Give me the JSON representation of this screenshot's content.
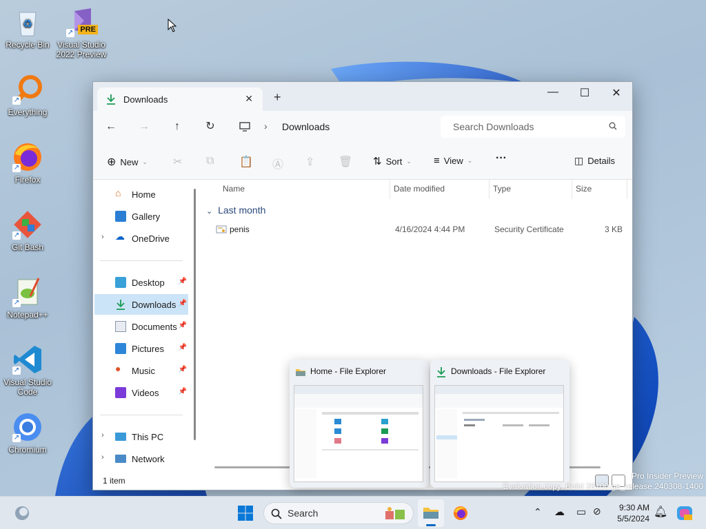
{
  "desktop": {
    "icons": [
      {
        "label": "Recycle Bin"
      },
      {
        "label": "Visual Studio 2022 Preview"
      },
      {
        "label": "Everything"
      },
      {
        "label": "Firefox"
      },
      {
        "label": "Git Bash"
      },
      {
        "label": "Notepad++"
      },
      {
        "label": "Visual Studio Code"
      },
      {
        "label": "Chromium"
      }
    ],
    "vs_badge": "PRE",
    "watermark_line1": "Pro Insider Preview",
    "watermark_line2": "Evaluation copy. Build 26100.ge_release.240308-1400"
  },
  "window": {
    "tab_title": "Downloads",
    "breadcrumb": "Downloads",
    "search_placeholder": "Search Downloads",
    "toolbar": {
      "new_label": "New",
      "sort_label": "Sort",
      "view_label": "View",
      "more_label": "···",
      "details_label": "Details"
    },
    "nav": {
      "home": "Home",
      "gallery": "Gallery",
      "onedrive": "OneDrive",
      "desktop": "Desktop",
      "downloads": "Downloads",
      "documents": "Documents",
      "pictures": "Pictures",
      "music": "Music",
      "videos": "Videos",
      "thispc": "This PC",
      "network": "Network"
    },
    "columns": {
      "name": "Name",
      "date": "Date modified",
      "type": "Type",
      "size": "Size"
    },
    "group_label": "Last month",
    "files": [
      {
        "name": "penis",
        "date": "4/16/2024 4:44 PM",
        "type": "Security Certificate",
        "size": "3 KB"
      }
    ],
    "status": "1 item"
  },
  "thumbnails": [
    {
      "title": "Home - File Explorer"
    },
    {
      "title": "Downloads - File Explorer"
    }
  ],
  "taskbar": {
    "search_label": "Search",
    "time": "9:30 AM",
    "date": "5/5/2024"
  },
  "colors": {
    "accent": "#0067c0",
    "selection": "#cce4f7"
  }
}
